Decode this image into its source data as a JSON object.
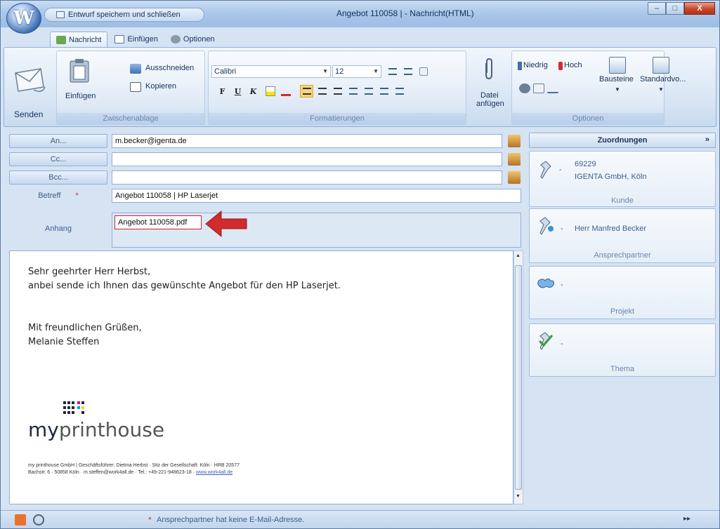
{
  "window": {
    "title": "Angebot 110058 |  - Nachricht(HTML)",
    "qat_label": "Entwurf speichern und schließen",
    "orb_letter": "W",
    "btn_min": "–",
    "btn_max": "□",
    "btn_close": "X"
  },
  "tabs": [
    {
      "label": "Nachricht"
    },
    {
      "label": "Einfügen"
    },
    {
      "label": "Optionen"
    }
  ],
  "ribbon": {
    "send_label": "Senden",
    "clipboard": {
      "paste_label": "Einfügen",
      "cut_label": "Ausschneiden",
      "copy_label": "Kopieren",
      "group_label": "Zwischenablage"
    },
    "format": {
      "font": "Calibri",
      "size": "12",
      "bold": "F",
      "underline": "U",
      "italic": "K",
      "group_label": "Formatierungen"
    },
    "attach_line1": "Datei",
    "attach_line2": "anfügen",
    "options": {
      "low_label": "Niedrig",
      "high_label": "Hoch",
      "blocks_label": "Bausteine",
      "standard_label": "Standardvo...",
      "group_label": "Optionen"
    }
  },
  "header": {
    "to_label": "An...",
    "cc_label": "Cc...",
    "bcc_label": "Bcc...",
    "subject_label": "Betreff",
    "attachment_label": "Anhang",
    "to_value": "m.becker@igenta.de",
    "cc_value": "",
    "bcc_value": "",
    "subject_value": "Angebot 110058 | HP Laserjet",
    "attachment_file": "Angebot 110058.pdf"
  },
  "message": {
    "line1": "Sehr geehrter Herr Herbst,",
    "line2": "anbei sende ich Ihnen das gewünschte Angebot für den HP Laserjet.",
    "line3": "Mit freundlichen Grüßen,",
    "line4": "Melanie Steffen",
    "logo_my": "my",
    "logo_rest": "printhouse",
    "footer1": "my printhouse GmbH | Geschäftsführer: Dietma Herbst · Sitz der Gesellschaft: Köln · HRB 20577",
    "footer2_prefix": "Bachstr. 6 · 50858 Köln · m.steffen@work4all.de · Tel.: +49-221-948623-18 · ",
    "footer2_link": "www.work4all.de"
  },
  "panel": {
    "title": "Zuordnungen",
    "collapse": "»",
    "customer_num": "69229",
    "customer_name": "IGENTA GmbH, Köln",
    "customer_label": "Kunde",
    "contact_name": "Herr Manfred Becker",
    "contact_label": "Ansprechpartner",
    "project_label": "Projekt",
    "topic_label": "Thema",
    "dash": "-"
  },
  "status": {
    "message": "Ansprechpartner hat keine E-Mail-Adresse.",
    "marker": "*",
    "nav": "▸▸"
  },
  "colors": {
    "arrow": "#d12b2b",
    "accent": "#8fb0d8"
  }
}
